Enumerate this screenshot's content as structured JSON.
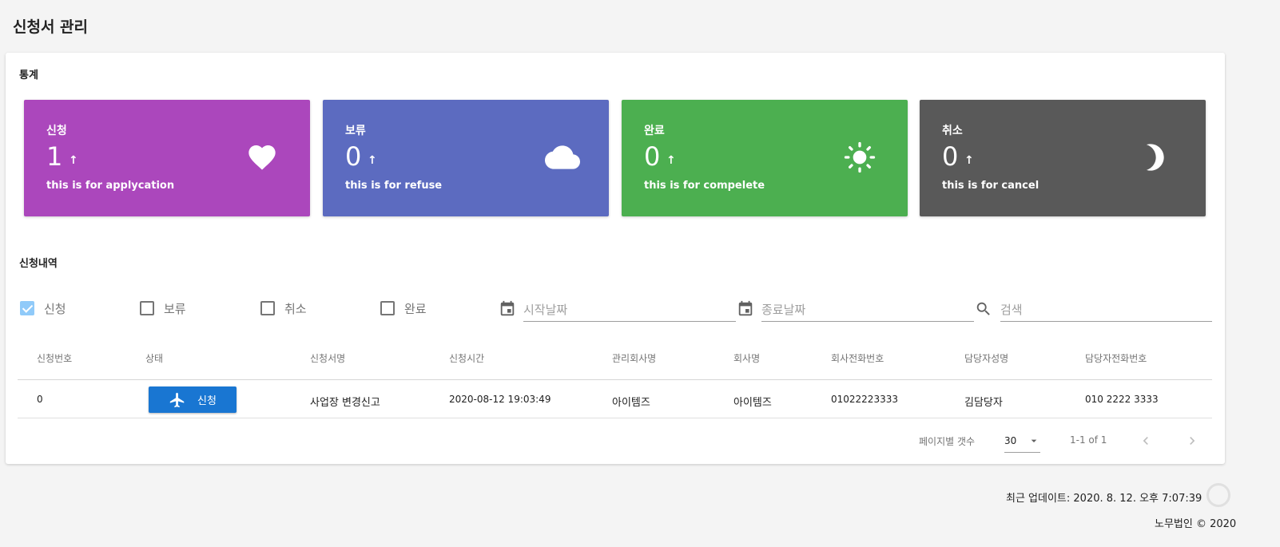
{
  "page": {
    "title": "신청서 관리"
  },
  "stats": {
    "section_title": "통계",
    "cards": [
      {
        "label": "신청",
        "value": "1",
        "arrow": "↑",
        "desc": "this is for applycation",
        "icon": "heart-icon",
        "color": "#ab47bc"
      },
      {
        "label": "보류",
        "value": "0",
        "arrow": "↑",
        "desc": "this is for refuse",
        "icon": "cloud-icon",
        "color": "#5c6bc0"
      },
      {
        "label": "완료",
        "value": "0",
        "arrow": "↑",
        "desc": "this is for compelete",
        "icon": "sun-icon",
        "color": "#4caf50"
      },
      {
        "label": "취소",
        "value": "0",
        "arrow": "↑",
        "desc": "this is for cancel",
        "icon": "moon-icon",
        "color": "#595959"
      }
    ]
  },
  "history": {
    "section_title": "신청내역",
    "filters": {
      "checkboxes": [
        {
          "label": "신청",
          "checked": true
        },
        {
          "label": "보류",
          "checked": false
        },
        {
          "label": "취소",
          "checked": false
        },
        {
          "label": "완료",
          "checked": false
        }
      ],
      "start_date_placeholder": "시작날짜",
      "end_date_placeholder": "종료날짜",
      "search_placeholder": "검색"
    },
    "columns": [
      "신청번호",
      "상태",
      "신청서명",
      "신청시간",
      "관리회사명",
      "회사명",
      "회사전화번호",
      "담당자성명",
      "담당자전화번호"
    ],
    "rows": [
      {
        "no": "0",
        "status": "신청",
        "form_name": "사업장 변경신고",
        "time": "2020-08-12 19:03:49",
        "mgmt_company": "아이템즈",
        "company": "아이템즈",
        "company_phone": "01022223333",
        "manager_name": "김담당자",
        "manager_phone": "010 2222 3333"
      }
    ],
    "pagination": {
      "rows_per_page_label": "페이지별 갯수",
      "rows_per_page": "30",
      "range": "1-1 of 1"
    }
  },
  "footer": {
    "last_update": "최근 업데이트: 2020. 8. 12. 오후 7:07:39",
    "copyright": "노무법인 © 2020"
  }
}
